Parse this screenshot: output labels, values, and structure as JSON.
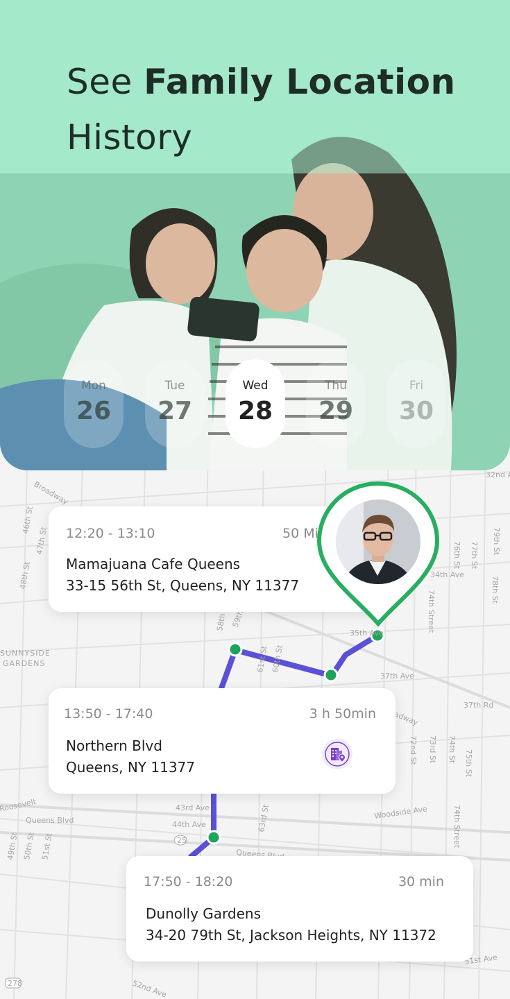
{
  "headline": {
    "regular": "See ",
    "bold": "Family Location",
    "line2": "History"
  },
  "days": [
    {
      "name": "Mon",
      "date": "26"
    },
    {
      "name": "Tue",
      "date": "27"
    },
    {
      "name": "Wed",
      "date": "28",
      "selected": true
    },
    {
      "name": "Thu",
      "date": "29"
    },
    {
      "name": "Fri",
      "date": "30"
    }
  ],
  "visits": [
    {
      "time": "12:20 - 13:10",
      "duration": "50 Min",
      "name": "Mamajuana Cafe Queens",
      "address": "33-15 56th St, Queens, NY 11377"
    },
    {
      "time": "13:50 - 17:40",
      "duration": "3 h 50min",
      "name": "Northern Blvd",
      "address": "Queens, NY 11377",
      "icon": "building-location-icon"
    },
    {
      "time": "17:50 - 18:20",
      "duration": "30 min",
      "name": "Dunolly Gardens",
      "address": "34-20 79th St, Jackson Heights, NY 11372"
    }
  ],
  "map_labels": {
    "sunnyside": "SUNNYSIDE",
    "gardens": "GARDENS",
    "broadway_top": "Broadway",
    "broadway": "Broadway",
    "queens_blvd": "Queens Blvd",
    "queens_blvd_2": "Queens Blvd",
    "woodside_ave": "Woodside Ave",
    "roosevelt": "Roosevelt",
    "ave_37": "37th Ave",
    "ave_34": "34th Ave",
    "ave_35": "35th Ave",
    "ave_32nd": "32nd Ave",
    "ave_43": "43rd Ave",
    "ave_44": "44th Ave",
    "ave_52nd": "52nd Ave",
    "ave_51st": "51st Ave",
    "ave_37rd": "37th Rd",
    "st_72nd": "72nd St",
    "st_73rd": "73rd St",
    "st_74th": "74th St",
    "st_75th": "75th St",
    "st_76th": "76th St",
    "st_77th": "77th St",
    "st_78th": "78th St",
    "st_79th": "79th St",
    "st_58th": "58th St",
    "st_59th": "59th St",
    "st_48th": "48th St",
    "st_49th": "49th St",
    "st_46th": "46th St",
    "st_47th": "47th St",
    "st_51st": "51st St",
    "st_50th": "50th St",
    "st_63rd": "63rd St",
    "st_61st": "61st St",
    "st_60th": "60th St",
    "st_74th_street": "74th Street",
    "route_25": "25",
    "route_278": "278"
  },
  "colors": {
    "route": "#5b50d6",
    "stop": "#1ea45a",
    "pin": "#27ae60",
    "hero": "#9fe0c2",
    "accent_purple": "#7b3fc9"
  }
}
